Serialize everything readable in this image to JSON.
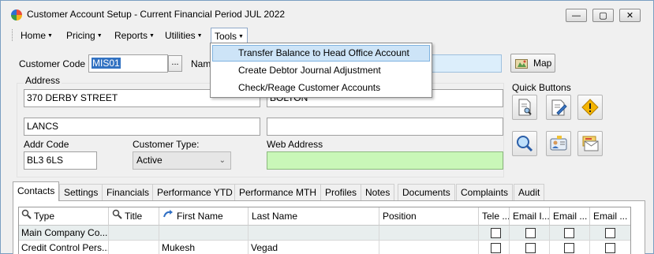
{
  "window": {
    "title": "Customer Account Setup - Current Financial Period JUL 2022",
    "minimize_glyph": "—",
    "maximize_glyph": "▢",
    "close_glyph": "✕"
  },
  "menu": {
    "items": [
      {
        "label": "Home"
      },
      {
        "label": "Pricing"
      },
      {
        "label": "Reports"
      },
      {
        "label": "Utilities"
      },
      {
        "label": "Tools"
      }
    ],
    "caret": "▼"
  },
  "tools_menu": {
    "items": [
      {
        "label": "Transfer Balance to Head Office Account"
      },
      {
        "label": "Create Debtor Journal Adjustment"
      },
      {
        "label": "Check/Reage Customer Accounts"
      }
    ]
  },
  "form": {
    "customer_code_label": "Customer Code",
    "customer_code_value": "MIS01",
    "lookup_button": "...",
    "name_label": "Nam",
    "map_button": "Map",
    "address_label": "Address",
    "address_line1": "370 DERBY STREET",
    "address_line2": "BOLTON",
    "address_line3": "LANCS",
    "address_line4": "",
    "addr_code_label": "Addr Code",
    "addr_code_value": "BL3  6LS",
    "customer_type_label": "Customer Type:",
    "customer_type_value": "Active",
    "web_address_label": "Web Address",
    "web_address_value": "",
    "quick_buttons_label": "Quick Buttons"
  },
  "quick_buttons": [
    {
      "name": "document-search-icon"
    },
    {
      "name": "edit-document-icon"
    },
    {
      "name": "warning-icon"
    },
    {
      "name": "magnifier-icon"
    },
    {
      "name": "contact-card-icon"
    },
    {
      "name": "mail-icon"
    }
  ],
  "tabs": [
    {
      "label": "Contacts",
      "active": true
    },
    {
      "label": "Settings"
    },
    {
      "label": "Financials"
    },
    {
      "label": "Performance YTD"
    },
    {
      "label": "Performance MTH"
    },
    {
      "label": "Profiles"
    },
    {
      "label": "Notes"
    },
    {
      "label": "Documents"
    },
    {
      "label": "Complaints"
    },
    {
      "label": "Audit"
    }
  ],
  "contacts_grid": {
    "columns": [
      "Type",
      "Title",
      "First Name",
      "Last Name",
      "Position",
      "Tele ...",
      "Email I...",
      "Email ...",
      "Email ..."
    ],
    "rows": [
      {
        "type": "Main Company Co...",
        "title": "",
        "first_name": "",
        "last_name": "",
        "position": ""
      },
      {
        "type": "Credit Control Pers...",
        "title": "",
        "first_name": "Mukesh",
        "last_name": "Vegad",
        "position": ""
      }
    ]
  },
  "colors": {
    "selection": "#3272c2",
    "menu_highlight": "#cde4f7",
    "web_field": "#c9f7b8",
    "grid_alt_row": "#e8eeee"
  }
}
